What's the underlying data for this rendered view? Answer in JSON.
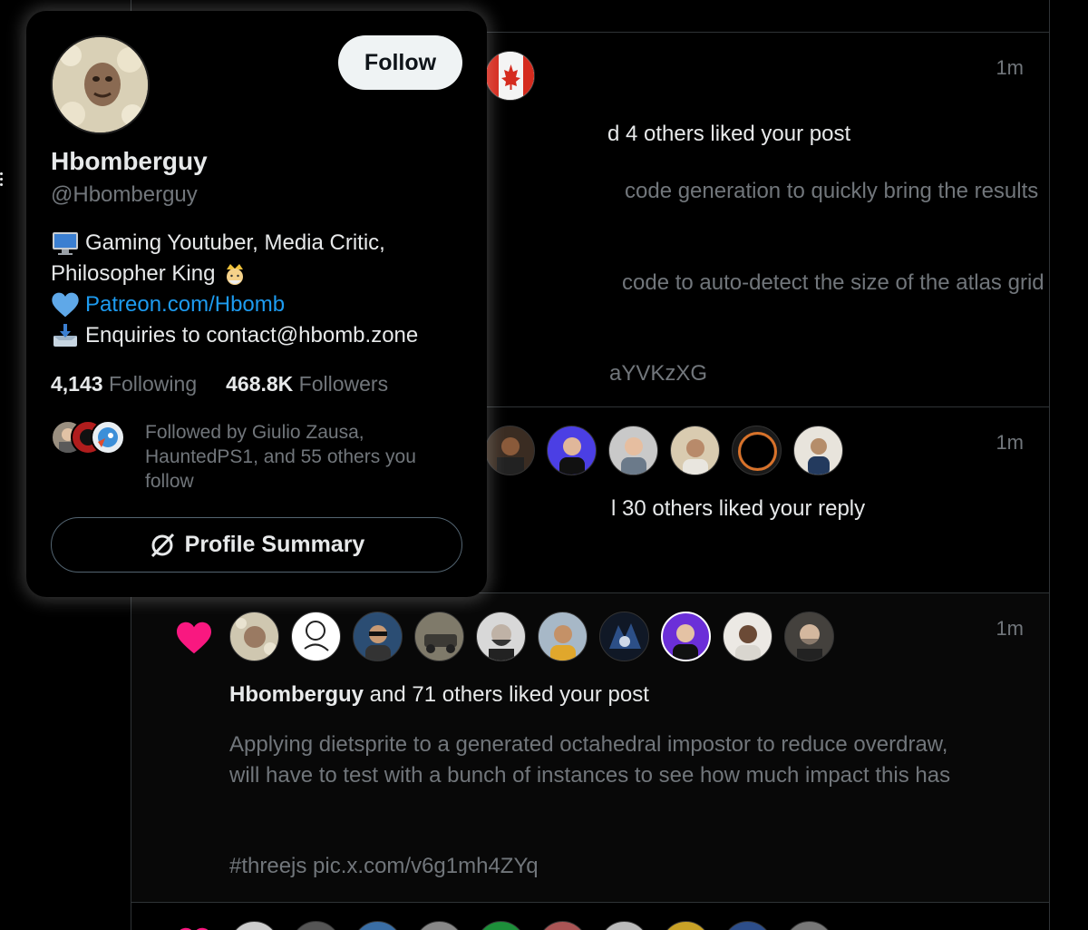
{
  "card": {
    "follow_label": "Follow",
    "name": "Hbomberguy",
    "handle": "@Hbomberguy",
    "bio_line1": "Gaming Youtuber, Media Critic,",
    "bio_line2": "Philosopher King",
    "bio_link": "Patreon.com/Hbomb",
    "bio_line4": "Enquiries to contact@hbomb.zone",
    "following_count": "4,143",
    "following_label": "Following",
    "followers_count": "468.8K",
    "followers_label": "Followers",
    "followed_by": "Followed by Giulio Zausa, HauntedPS1, and 55 others you follow",
    "summary_label": "Profile Summary"
  },
  "notifications": [
    {
      "time": "1m",
      "liked_text": "d 4 others liked your post",
      "line1": "code generation to quickly bring the results",
      "line2": "code to auto-detect the size of the atlas grid",
      "link": "aYVKzXG"
    },
    {
      "time": "1m",
      "liked_text": "l 30 others liked your reply"
    },
    {
      "time": "1m",
      "actor": "Hbomberguy",
      "liked_text": " and 71 others liked your post",
      "body": "Applying dietsprite to a generated octahedral impostor to reduce overdraw, will have to test with a bunch of instances to see how much impact this has",
      "link": "#threejs pic.x.com/v6g1mh4ZYq"
    }
  ],
  "colors": {
    "accent": "#1d9bf0",
    "heart": "#f91880",
    "muted": "#71767b",
    "text": "#e7e9ea"
  }
}
